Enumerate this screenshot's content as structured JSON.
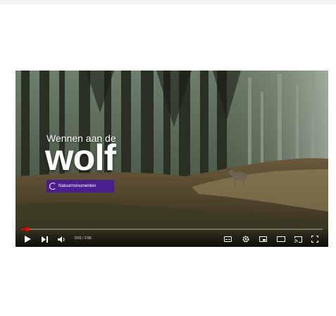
{
  "video": {
    "title_line1": "Wennen aan de",
    "title_line2": "wolf",
    "brand_label": "Natuurmonumenten",
    "time_display": "0:01 / 2:56",
    "progress": 0.02
  },
  "controls": {
    "play_icon": "play-icon",
    "next_icon": "next-icon",
    "volume_icon": "volume-icon",
    "right_icons": [
      "subtitles-icon",
      "settings-icon",
      "miniplayer-icon",
      "theater-icon",
      "cast-icon",
      "fullscreen-icon"
    ]
  },
  "colors": {
    "progress": "#ff0000",
    "brand_badge": "#4b1e8f"
  }
}
